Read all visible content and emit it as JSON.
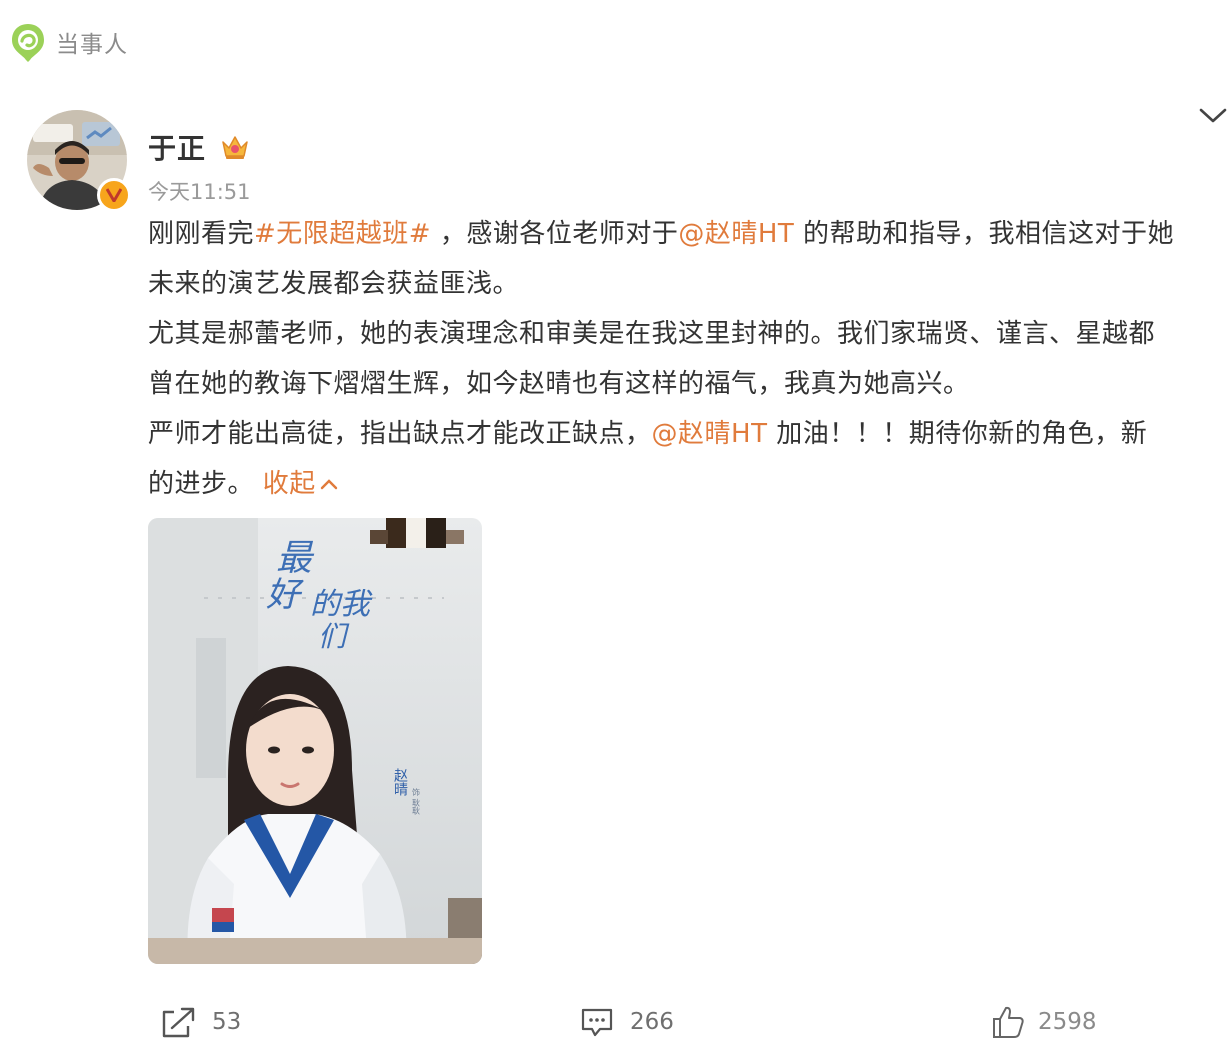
{
  "topic": {
    "label": "当事人",
    "icon": "topic-pin-icon",
    "icon_color": "#8cc63f"
  },
  "post": {
    "author": "于正",
    "time": "今天11:51",
    "badges": [
      "verified-v-icon",
      "crown-icon"
    ],
    "lines": [
      {
        "parts": [
          {
            "type": "text",
            "text": "刚刚看完"
          },
          {
            "type": "tag",
            "text": "#无限超越班#"
          },
          {
            "type": "text",
            "text": " ，感谢各位老师对于"
          },
          {
            "type": "mention",
            "text": "@赵晴HT"
          },
          {
            "type": "text",
            "text": " 的帮助和指导，我相信这对于她"
          }
        ]
      },
      {
        "parts": [
          {
            "type": "text",
            "text": "未来的演艺发展都会获益匪浅。"
          }
        ]
      },
      {
        "parts": [
          {
            "type": "text",
            "text": "尤其是郝蕾老师，她的表演理念和审美是在我这里封神的。我们家瑞贤、谨言、星越都"
          }
        ]
      },
      {
        "parts": [
          {
            "type": "text",
            "text": "曾在她的教诲下熠熠生辉，如今赵晴也有这样的福气，我真为她高兴。"
          }
        ]
      },
      {
        "parts": [
          {
            "type": "text",
            "text": "严师才能出高徒，指出缺点才能改正缺点，"
          },
          {
            "type": "mention",
            "text": "@赵晴HT"
          },
          {
            "type": "text",
            "text": " 加油！！！期待你新的角色，新"
          }
        ]
      },
      {
        "parts": [
          {
            "type": "text",
            "text": "的进步。 "
          },
          {
            "type": "collapse",
            "text": "收起"
          }
        ]
      }
    ],
    "image": {
      "alt": "剧照海报",
      "poster_title_lines": [
        "最",
        "好",
        "的我",
        "们"
      ],
      "caption_name": "赵晴",
      "caption_role": "饰 耿耿"
    },
    "actions": {
      "repost": {
        "count": "53",
        "icon": "share-icon"
      },
      "comment": {
        "count": "266",
        "icon": "comment-icon"
      },
      "like": {
        "count": "2598",
        "icon": "thumbs-up-icon"
      }
    }
  },
  "colors": {
    "accent": "#e07b3c",
    "text": "#333333",
    "muted": "#9a9a9a",
    "verified": "#f7a51c"
  }
}
